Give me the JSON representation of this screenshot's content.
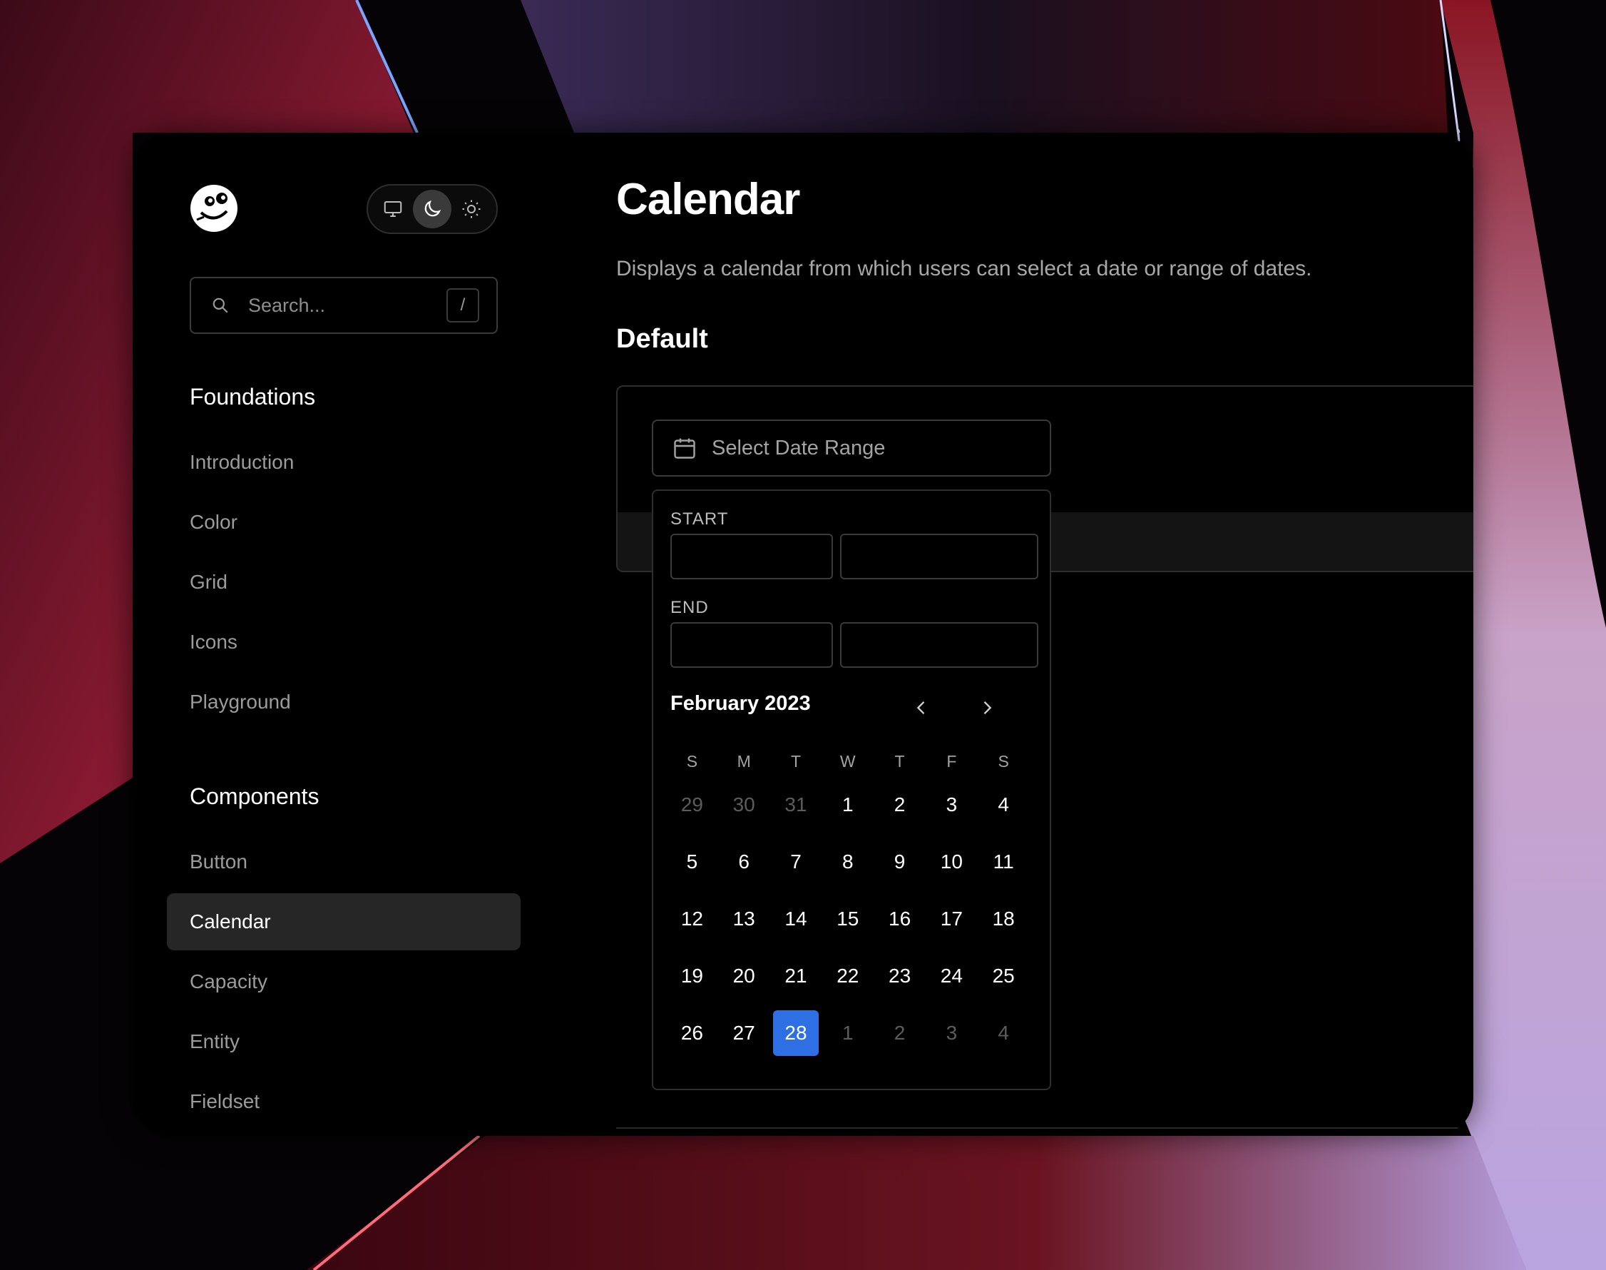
{
  "theme": {
    "options": [
      "system",
      "dark",
      "light"
    ],
    "selected": "dark"
  },
  "search": {
    "placeholder": "Search...",
    "shortcut": "/"
  },
  "sidebar": {
    "foundations_title": "Foundations",
    "foundations": [
      "Introduction",
      "Color",
      "Grid",
      "Icons",
      "Playground"
    ],
    "components_title": "Components",
    "components": [
      "Button",
      "Calendar",
      "Capacity",
      "Entity",
      "Fieldset"
    ],
    "active": "Calendar"
  },
  "main": {
    "title": "Calendar",
    "description": "Displays a calendar from which users can select a date or range of dates.",
    "section": "Default"
  },
  "date_picker": {
    "trigger_label": "Select Date Range",
    "start_label": "START",
    "end_label": "END",
    "month_label": "February 2023",
    "weekdays": [
      "S",
      "M",
      "T",
      "W",
      "T",
      "F",
      "S"
    ],
    "weeks": [
      [
        {
          "d": "29",
          "out": true
        },
        {
          "d": "30",
          "out": true
        },
        {
          "d": "31",
          "out": true
        },
        {
          "d": "1"
        },
        {
          "d": "2"
        },
        {
          "d": "3"
        },
        {
          "d": "4"
        }
      ],
      [
        {
          "d": "5"
        },
        {
          "d": "6"
        },
        {
          "d": "7"
        },
        {
          "d": "8"
        },
        {
          "d": "9"
        },
        {
          "d": "10"
        },
        {
          "d": "11"
        }
      ],
      [
        {
          "d": "12"
        },
        {
          "d": "13"
        },
        {
          "d": "14"
        },
        {
          "d": "15"
        },
        {
          "d": "16"
        },
        {
          "d": "17"
        },
        {
          "d": "18"
        }
      ],
      [
        {
          "d": "19"
        },
        {
          "d": "20"
        },
        {
          "d": "21"
        },
        {
          "d": "22"
        },
        {
          "d": "23"
        },
        {
          "d": "24"
        },
        {
          "d": "25"
        }
      ],
      [
        {
          "d": "26"
        },
        {
          "d": "27"
        },
        {
          "d": "28",
          "selected": true
        },
        {
          "d": "1",
          "out": true
        },
        {
          "d": "2",
          "out": true
        },
        {
          "d": "3",
          "out": true
        },
        {
          "d": "4",
          "out": true
        }
      ]
    ],
    "selected_color": "#2f6fe4"
  }
}
